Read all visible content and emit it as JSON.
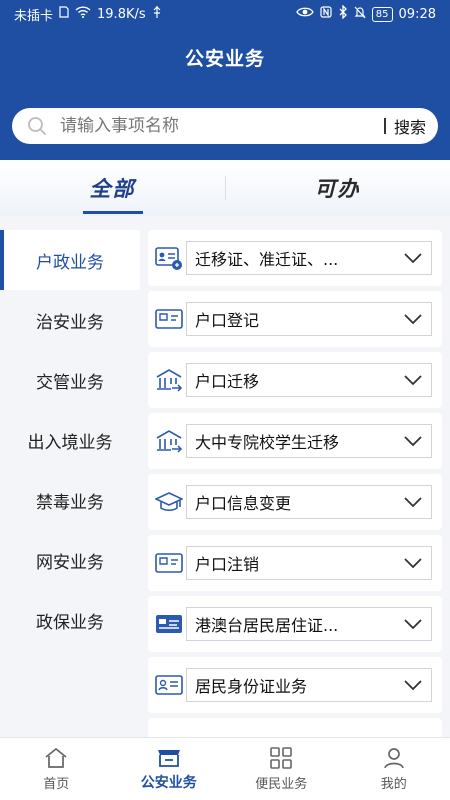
{
  "status_bar": {
    "carrier": "未插卡",
    "speed": "19.8K/s",
    "battery": "85",
    "time": "09:28"
  },
  "header": {
    "title": "公安业务"
  },
  "search": {
    "placeholder": "请输入事项名称",
    "button_label": "搜索"
  },
  "tabs": [
    {
      "label": "全部",
      "active": true
    },
    {
      "label": "可办",
      "active": false
    }
  ],
  "sidebar": {
    "items": [
      {
        "label": "户政业务",
        "active": true
      },
      {
        "label": "治安业务"
      },
      {
        "label": "交管业务"
      },
      {
        "label": "出入境业务"
      },
      {
        "label": "禁毒业务"
      },
      {
        "label": "网安业务"
      },
      {
        "label": "政保业务"
      }
    ]
  },
  "services": [
    {
      "label": "迁移证、准迁证、...",
      "icon": "id-card-icon"
    },
    {
      "label": "户口登记",
      "icon": "hukou-book-icon"
    },
    {
      "label": "户口迁移",
      "icon": "building-move-icon"
    },
    {
      "label": "大中专院校学生迁移",
      "icon": "building-move-icon"
    },
    {
      "label": "户口信息变更",
      "icon": "graduation-cap-icon"
    },
    {
      "label": "户口注销",
      "icon": "hukou-book-icon"
    },
    {
      "label": "港澳台居民居住证...",
      "icon": "residence-card-icon"
    },
    {
      "label": "居民身份证业务",
      "icon": "identity-card-icon"
    }
  ],
  "bottom_nav": [
    {
      "label": "首页",
      "icon": "home-icon"
    },
    {
      "label": "公安业务",
      "icon": "police-service-icon",
      "active": true
    },
    {
      "label": "便民业务",
      "icon": "grid-icon"
    },
    {
      "label": "我的",
      "icon": "user-icon"
    }
  ],
  "colors": {
    "primary": "#1f4fa3",
    "background": "#f3f5f8"
  }
}
